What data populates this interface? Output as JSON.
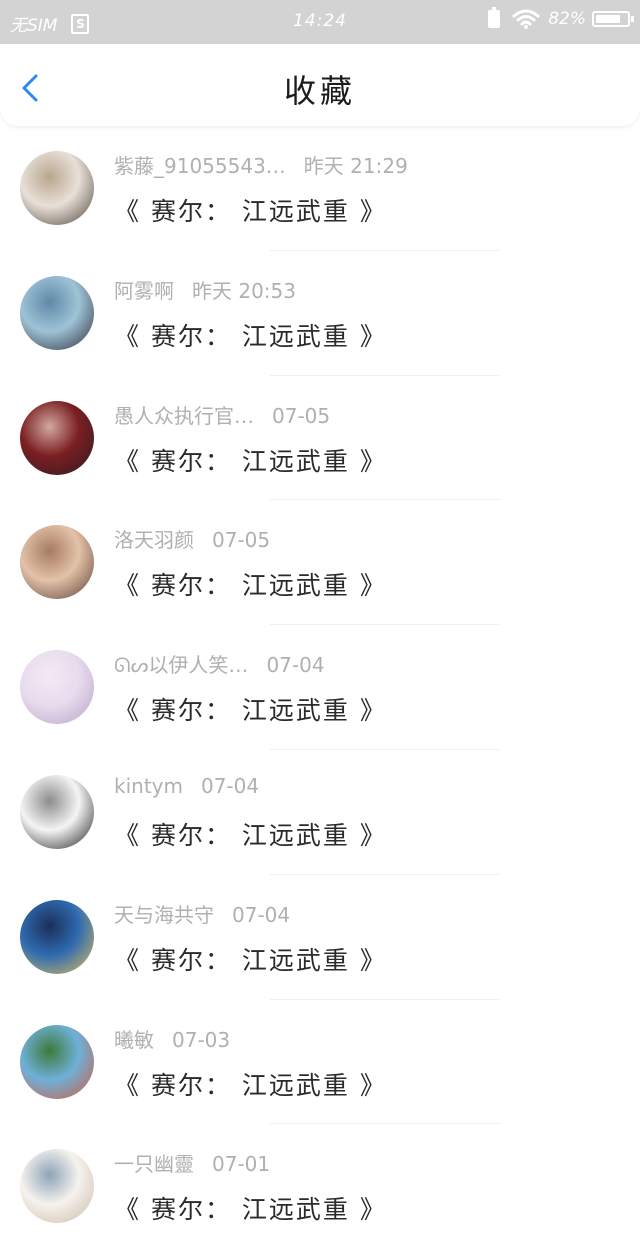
{
  "status_bar": {
    "carrier": "无SIM",
    "sim_icon_label": "S",
    "time": "14:24",
    "battery_percent": "82%",
    "battery_level": 0.82
  },
  "header": {
    "title": "收藏",
    "back_icon": "chevron-left-icon"
  },
  "colors": {
    "accent": "#2a8bf2",
    "status_bar_bg": "#d3d3d3",
    "meta_text": "#b0b0b0",
    "title_text": "#2a2a2a"
  },
  "items": [
    {
      "author": "紫藤_91055543…",
      "time": "昨天 21:29",
      "title": "《 赛尔： 江远武重 》",
      "avatar_colors": [
        "#e8e0d8",
        "#4a4238",
        "#b9a68f"
      ]
    },
    {
      "author": "阿雾啊",
      "time": "昨天 20:53",
      "title": "《 赛尔： 江远武重 》",
      "avatar_colors": [
        "#9ec3d6",
        "#2b2b3a",
        "#5f89a8"
      ]
    },
    {
      "author": "愚人众执行官…",
      "time": "07-05",
      "title": "《 赛尔： 江远武重 》",
      "avatar_colors": [
        "#7a1f22",
        "#2d1a20",
        "#d2a8a0"
      ]
    },
    {
      "author": "洛天羽颜",
      "time": "07-05",
      "title": "《 赛尔： 江远武重 》",
      "avatar_colors": [
        "#e2c2a8",
        "#5b3d33",
        "#a67b62"
      ]
    },
    {
      "author": "ᘏᔕ以伊人笑…",
      "time": "07-04",
      "title": "《 赛尔： 江远武重 》",
      "avatar_colors": [
        "#e8dcee",
        "#b5a3c7",
        "#f4e9f1"
      ]
    },
    {
      "author": "kintym",
      "time": "07-04",
      "title": "《 赛尔： 江远武重 》",
      "avatar_colors": [
        "#f4f4f4",
        "#1a1a1a",
        "#8c8c8c"
      ]
    },
    {
      "author": "天与海共守",
      "time": "07-04",
      "title": "《 赛尔： 江远武重 》",
      "avatar_colors": [
        "#2f6ab0",
        "#e3c35a",
        "#1b2f57"
      ]
    },
    {
      "author": "曦敏",
      "time": "07-03",
      "title": "《 赛尔： 江远武重 》",
      "avatar_colors": [
        "#6fb0d8",
        "#d45a3a",
        "#3d7a3a"
      ]
    },
    {
      "author": "一只幽靈",
      "time": "07-01",
      "title": "《 赛尔： 江远武重 》",
      "avatar_colors": [
        "#f6f2ee",
        "#c9b9a6",
        "#8da3b8"
      ]
    }
  ]
}
